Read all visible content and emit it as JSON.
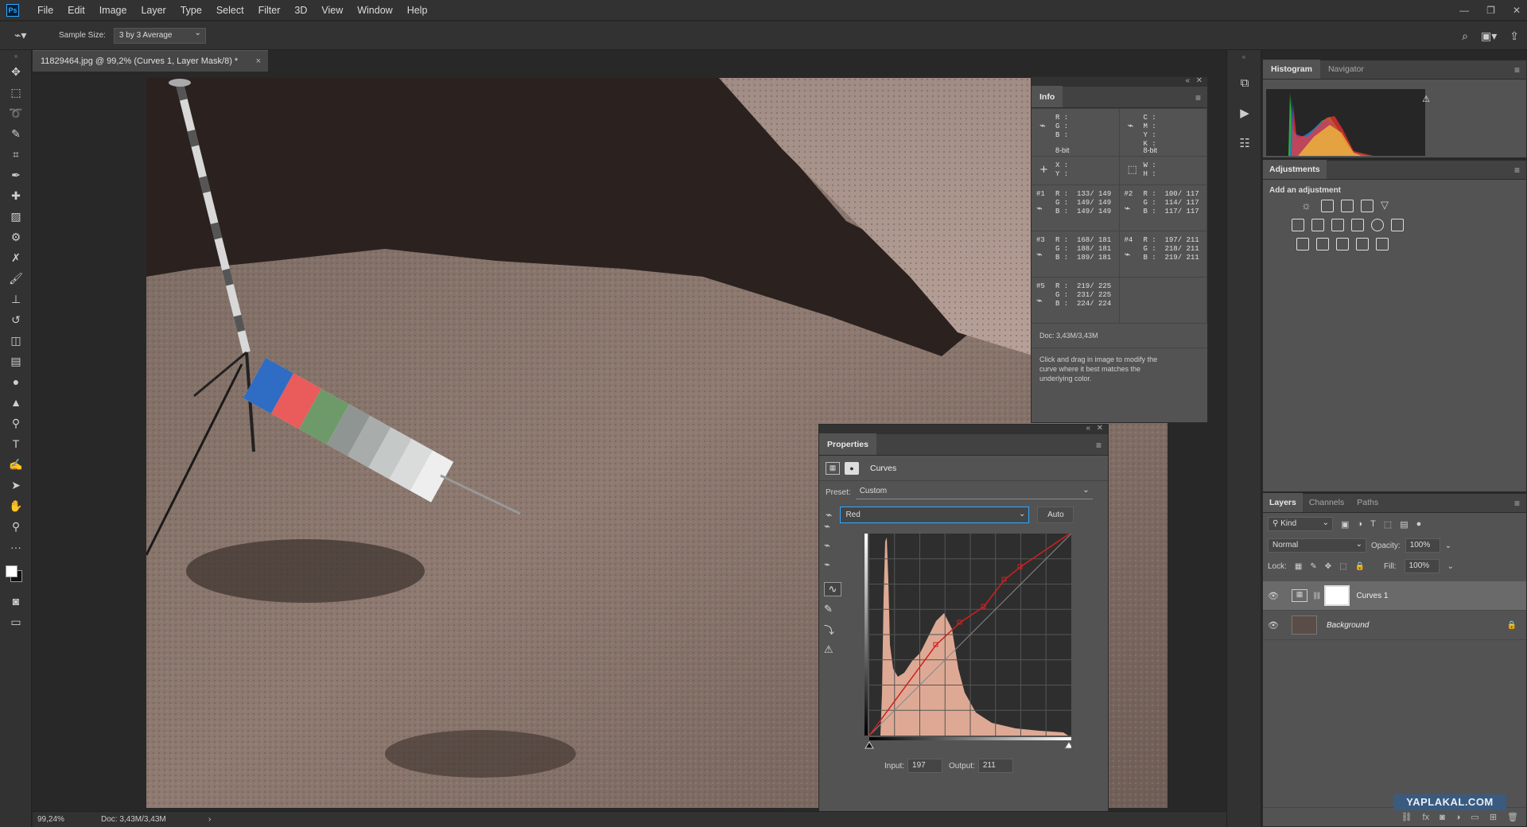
{
  "app": {
    "logo": "Ps"
  },
  "menubar": {
    "items": [
      "File",
      "Edit",
      "Image",
      "Layer",
      "Type",
      "Select",
      "Filter",
      "3D",
      "View",
      "Window",
      "Help"
    ]
  },
  "options": {
    "sample_size_label": "Sample Size:",
    "sample_size_value": "3 by 3 Average"
  },
  "document": {
    "tab_title": "11829464.jpg @ 99,2% (Curves 1, Layer Mask/8) *",
    "close": "×"
  },
  "status": {
    "zoom": "99,24%",
    "doc": "Doc: 3,43M/3,43M",
    "arrow": "›"
  },
  "info": {
    "tab": "Info",
    "rgb_labels": "R :\nG :\nB :",
    "cmyk_labels": "C :\nM :\nY :\nK :",
    "bit_left": "8-bit",
    "bit_right": "8-bit",
    "xy_labels": "X :\nY :",
    "wh_labels": "W :\nH :",
    "samples": [
      {
        "id": "#1",
        "text": "R :  133/ 149\nG :  149/ 149\nB :  149/ 149"
      },
      {
        "id": "#2",
        "text": "R :  100/ 117\nG :  114/ 117\nB :  117/ 117"
      },
      {
        "id": "#3",
        "text": "R :  168/ 181\nG :  188/ 181\nB :  189/ 181"
      },
      {
        "id": "#4",
        "text": "R :  197/ 211\nG :  218/ 211\nB :  219/ 211"
      },
      {
        "id": "#5",
        "text": "R :  219/ 225\nG :  231/ 225\nB :  224/ 224"
      }
    ],
    "doc": "Doc: 3,43M/3,43M",
    "hint": "Click and drag in image to modify the curve where it best matches the underlying color."
  },
  "properties": {
    "tab": "Properties",
    "adjustment_name": "Curves",
    "preset_label": "Preset:",
    "preset_value": "Custom",
    "channel_value": "Red",
    "auto_label": "Auto",
    "input_label": "Input:",
    "input_value": "197",
    "output_label": "Output:",
    "output_value": "211"
  },
  "histogram": {
    "tabs": [
      "Histogram",
      "Navigator"
    ]
  },
  "adjustments": {
    "tab": "Adjustments",
    "add_label": "Add an adjustment"
  },
  "layers": {
    "tabs": [
      "Layers",
      "Channels",
      "Paths"
    ],
    "kind_label": "Kind",
    "blend_mode": "Normal",
    "opacity_label": "Opacity:",
    "opacity_value": "100%",
    "lock_label": "Lock:",
    "fill_label": "Fill:",
    "fill_value": "100%",
    "items": [
      {
        "name": "Curves 1",
        "selected": true
      },
      {
        "name": "Background",
        "selected": false
      }
    ]
  },
  "watermark": "YAPLAKAL.COM",
  "colors": {
    "accent": "#31a8ff",
    "panel": "#535353",
    "chrome": "#323232",
    "curve": "#d02020",
    "histo_fill": "#e8b09a"
  }
}
